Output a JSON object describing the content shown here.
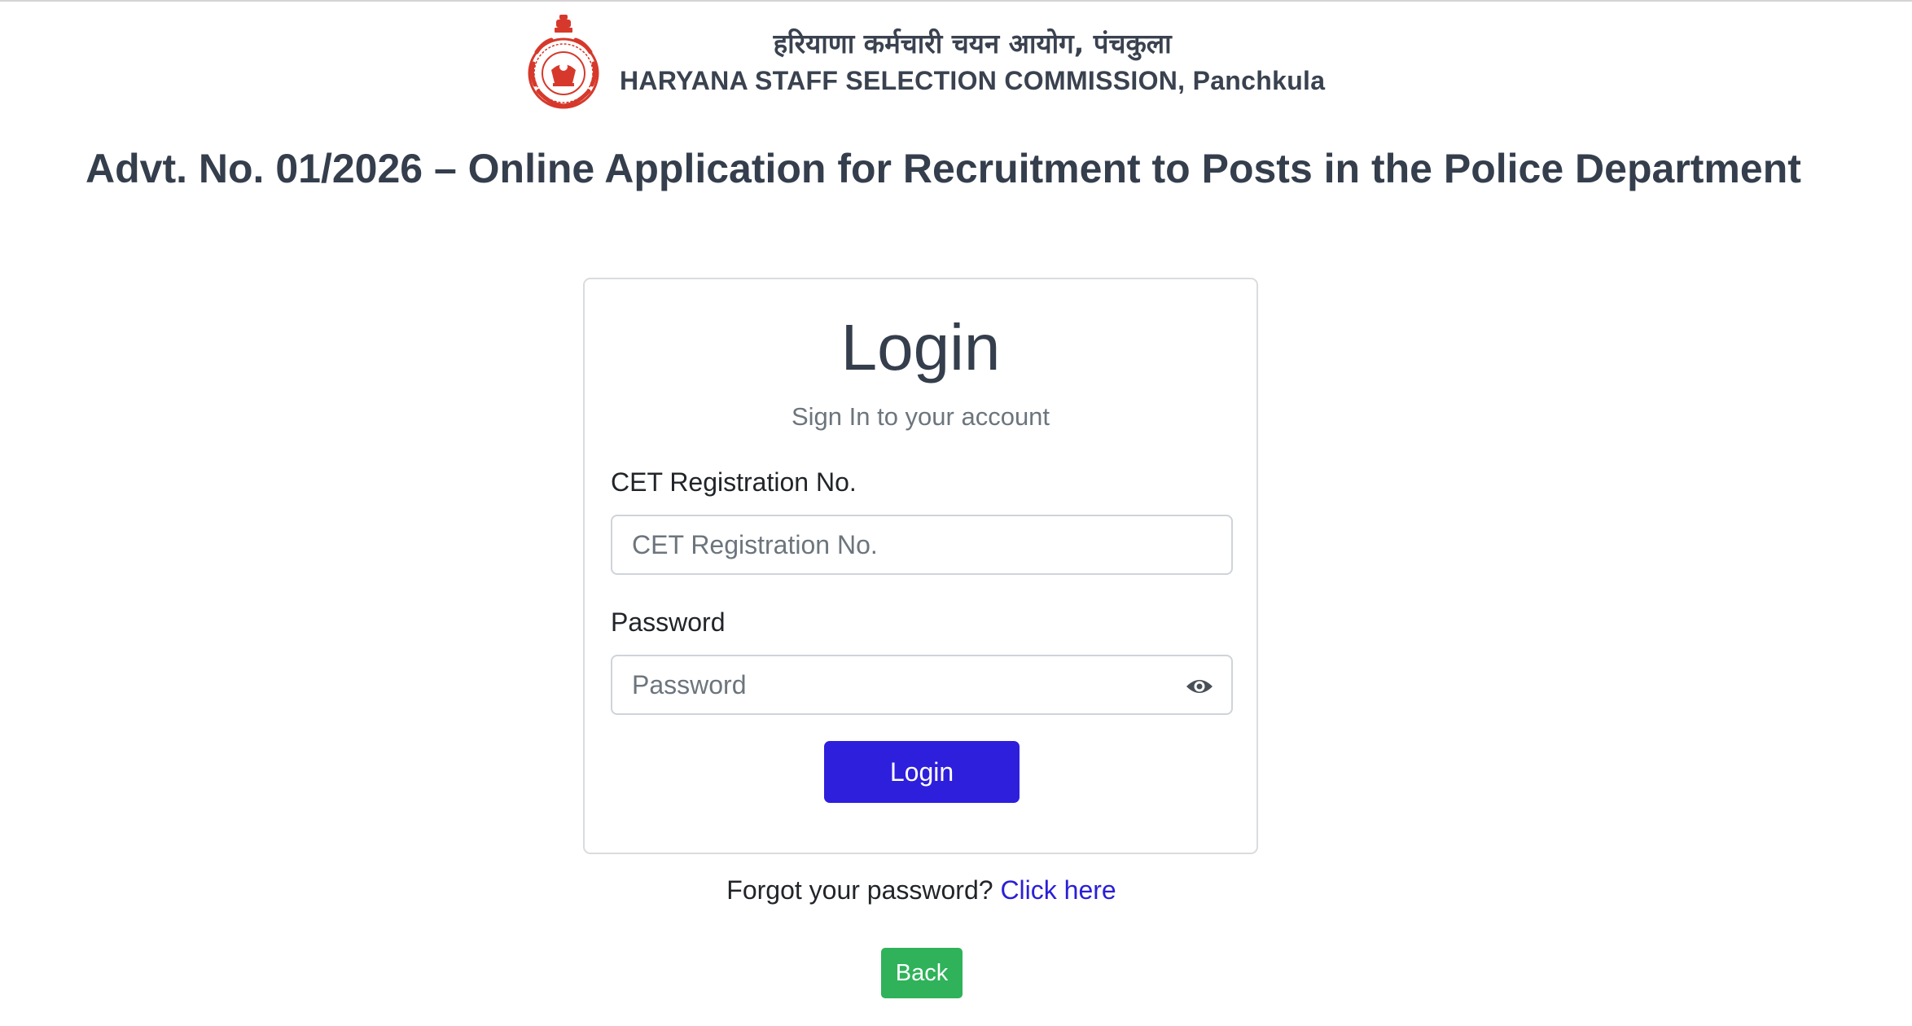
{
  "header": {
    "hindi_title": "हरियाणा कर्मचारी चयन आयोग, पंचकुला",
    "english_title": "HARYANA STAFF SELECTION COMMISSION, Panchkula",
    "emblem_icon": "haryana-emblem-icon"
  },
  "page": {
    "advt_heading": "Advt. No. 01/2026 – Online Application for Recruitment to Posts in the Police Department"
  },
  "login_card": {
    "title": "Login",
    "subtitle": "Sign In to your account",
    "registration": {
      "label": "CET Registration No.",
      "placeholder": "CET Registration No.",
      "value": ""
    },
    "password": {
      "label": "Password",
      "placeholder": "Password",
      "value": "",
      "toggle_icon": "eye-icon"
    },
    "login_button": "Login"
  },
  "forgot": {
    "text": "Forgot your password?",
    "link": "Click here"
  },
  "back_button": "Back",
  "colors": {
    "primary_button": "#2e1fdc",
    "back_button": "#2fb25a",
    "link": "#2a1fd6",
    "emblem_red": "#d6392c"
  }
}
